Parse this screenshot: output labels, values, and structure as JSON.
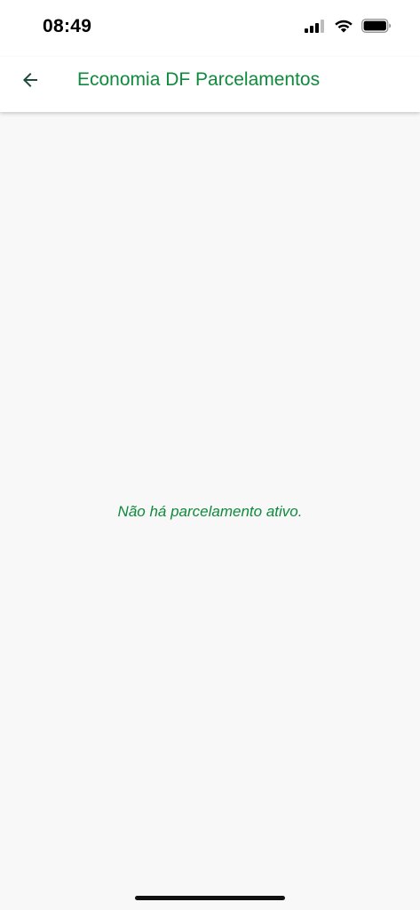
{
  "status_bar": {
    "time": "08:49",
    "icons": [
      "cellular-signal-icon",
      "wifi-icon",
      "battery-icon"
    ]
  },
  "app_bar": {
    "back_icon": "arrow-left-icon",
    "title": "Economia DF Parcelamentos"
  },
  "content": {
    "empty_message": "Não há parcelamento ativo."
  },
  "colors": {
    "accent": "#0f8a3c",
    "background": "#f8f8f8",
    "app_bar": "#ffffff",
    "back_arrow": "#1d4d3a"
  }
}
